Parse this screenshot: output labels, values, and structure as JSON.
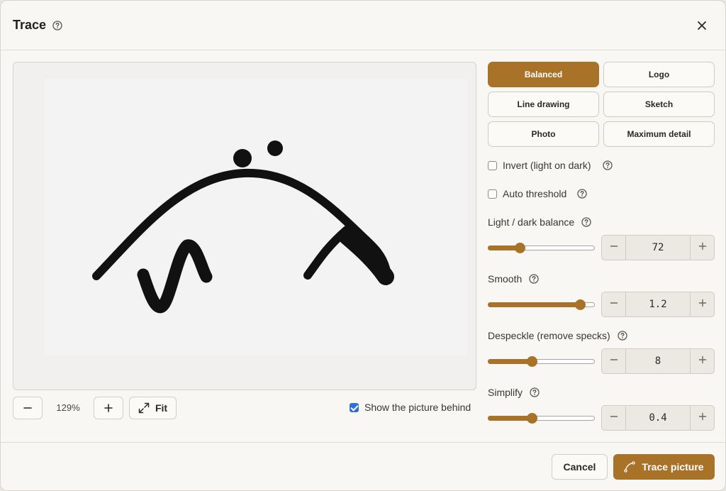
{
  "dialog": {
    "title": "Trace",
    "help_icon": "question-circle-icon",
    "close_icon": "close-icon"
  },
  "preview": {
    "zoom_level": "129%",
    "zoom_out_icon": "minus-icon",
    "zoom_in_icon": "plus-icon",
    "fit_label": "Fit",
    "fit_icon": "expand-arrows-icon",
    "show_behind_label": "Show the picture behind",
    "show_behind_checked": true
  },
  "presets": [
    {
      "label": "Balanced",
      "active": true
    },
    {
      "label": "Logo",
      "active": false
    },
    {
      "label": "Line drawing",
      "active": false
    },
    {
      "label": "Sketch",
      "active": false
    },
    {
      "label": "Photo",
      "active": false
    },
    {
      "label": "Maximum detail",
      "active": false
    }
  ],
  "options": {
    "invert_label": "Invert (light on dark)",
    "invert_checked": false,
    "auto_threshold_label": "Auto threshold",
    "auto_threshold_checked": false
  },
  "sliders": [
    {
      "label": "Light / dark balance",
      "value": "72",
      "fraction": 0.3
    },
    {
      "label": "Smooth",
      "value": "1.2",
      "fraction": 0.86
    },
    {
      "label": "Despeckle (remove specks)",
      "value": "8",
      "fraction": 0.41
    },
    {
      "label": "Simplify",
      "value": "0.4",
      "fraction": 0.41
    }
  ],
  "footer": {
    "cancel_label": "Cancel",
    "trace_label": "Trace picture",
    "trace_icon": "bezier-curve-icon"
  },
  "colors": {
    "accent": "#a87328",
    "checkbox": "#2f6fd6"
  }
}
